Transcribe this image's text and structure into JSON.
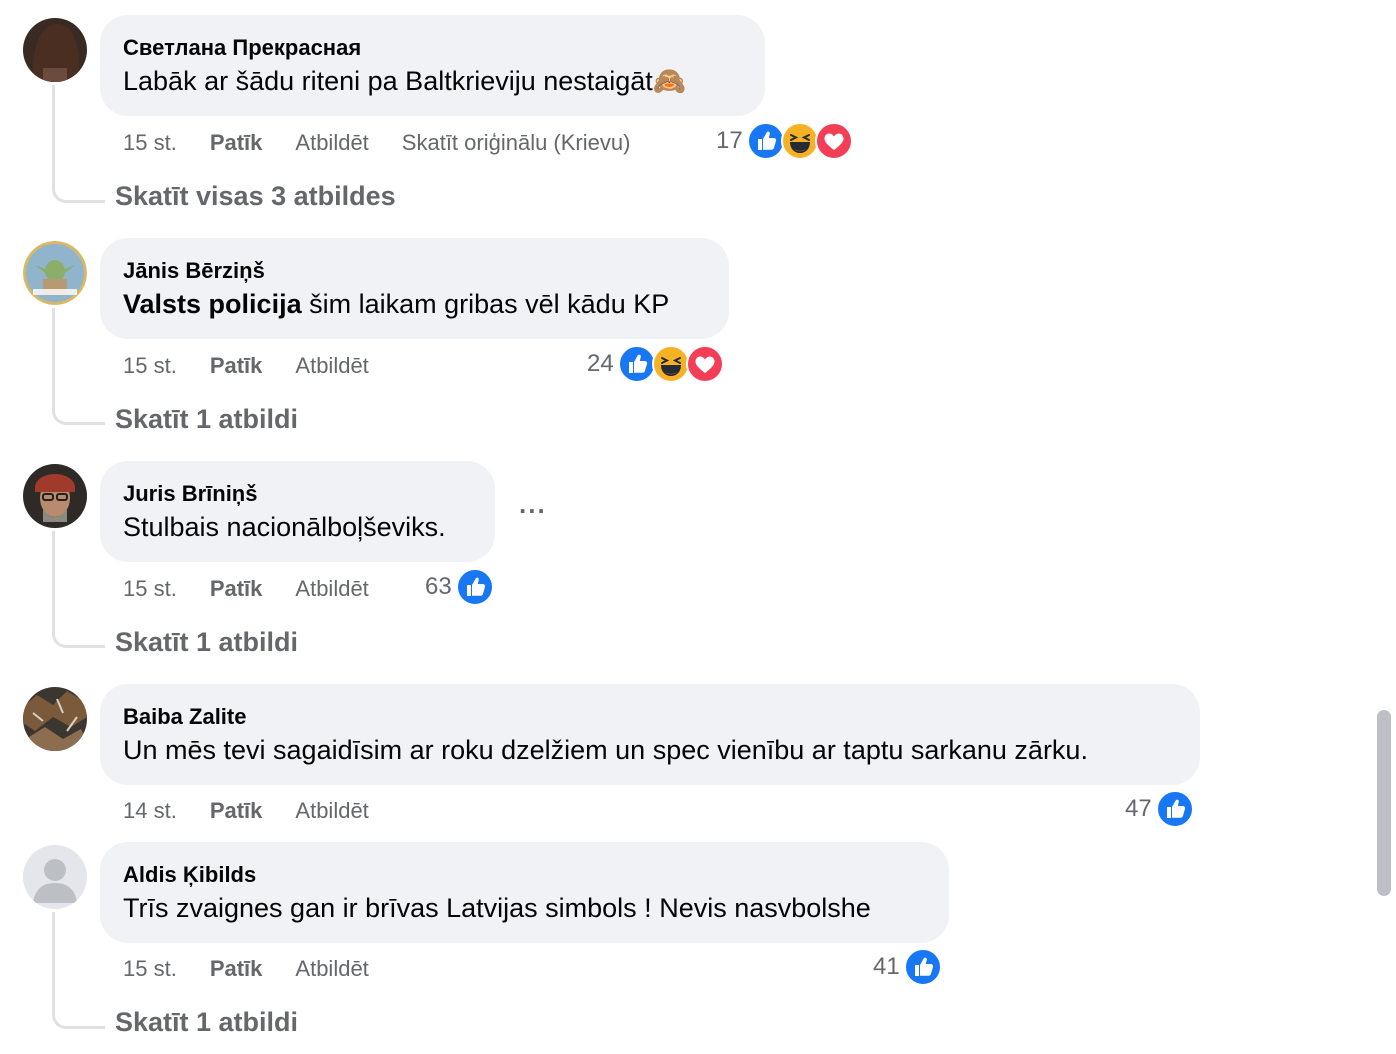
{
  "comments": [
    {
      "author": "Светлана Прекрасная",
      "text": "Labāk ar šādu riteni pa Baltkrieviju nestaigāt🙈",
      "time": "15 st.",
      "like": "Patīk",
      "reply": "Atbildēt",
      "extra": "Skatīt oriģinālu (Krievu)",
      "reaction_count": "17",
      "reactions": [
        "like-icon",
        "haha-icon",
        "love-icon"
      ],
      "view_replies": "Skatīt visas 3 atbildes"
    },
    {
      "author": "Jānis Bērziņš",
      "text_bold": "Valsts policija",
      "text": " šim laikam gribas vēl kādu KP",
      "time": "15 st.",
      "like": "Patīk",
      "reply": "Atbildēt",
      "reaction_count": "24",
      "reactions": [
        "like-icon",
        "haha-icon",
        "love-icon"
      ],
      "view_replies": "Skatīt 1 atbildi"
    },
    {
      "author": "Juris Brīniņš",
      "text": "Stulbais nacionālboļševiks.",
      "time": "15 st.",
      "like": "Patīk",
      "reply": "Atbildēt",
      "reaction_count": "63",
      "reactions": [
        "like-icon"
      ],
      "view_replies": "Skatīt 1 atbildi",
      "more": "..."
    },
    {
      "author": "Baiba Zalite",
      "text": "Un mēs tevi sagaidīsim ar roku dzelžiem un spec vienību ar taptu sarkanu zārku.",
      "time": "14 st.",
      "like": "Patīk",
      "reply": "Atbildēt",
      "reaction_count": "47",
      "reactions": [
        "like-icon"
      ]
    },
    {
      "author": "Aldis Ķibilds",
      "text": "Trīs zvaignes gan ir brīvas Latvijas simbols ! Nevis nasvbolshe",
      "time": "15 st.",
      "like": "Patīk",
      "reply": "Atbildēt",
      "reaction_count": "41",
      "reactions": [
        "like-icon"
      ],
      "view_replies": "Skatīt 1 atbildi"
    }
  ],
  "colors": {
    "bubble": "#f0f2f5",
    "meta": "#65676b",
    "like_blue": "#1877f2",
    "love_red": "#f33e58",
    "haha_yellow": "#f7b125"
  }
}
